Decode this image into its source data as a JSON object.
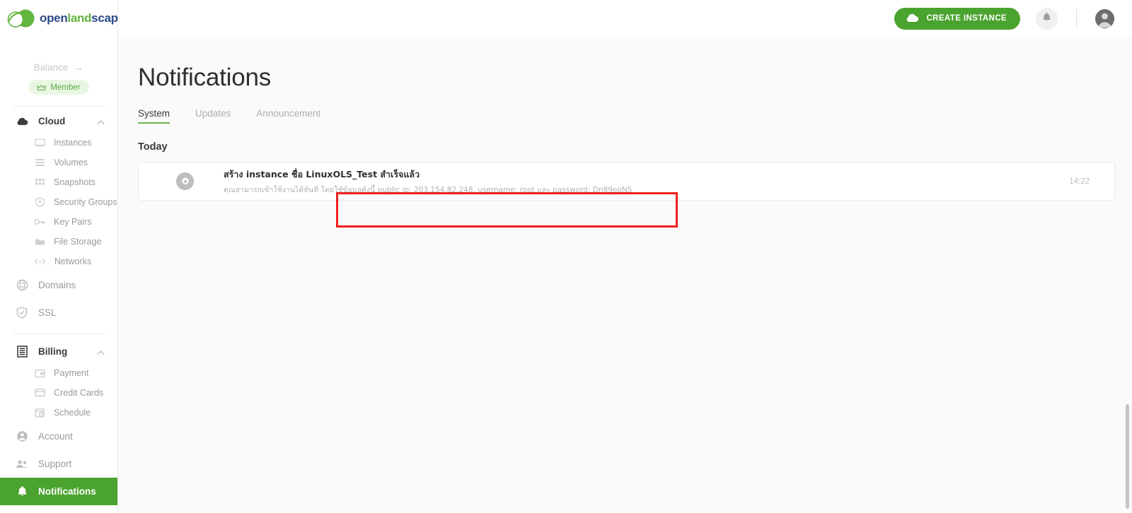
{
  "brand": {
    "logo_open": "open",
    "logo_land": "land",
    "logo_scape": "scape",
    "accent_green": "#4ba32f",
    "tab_underline_green": "#6cb24a",
    "badge_bg": "#e9f7e2",
    "annotation_red": "#ef2020"
  },
  "sidebar": {
    "balance_label": "Balance",
    "balance_arrow": "→",
    "member_badge": "Member",
    "groups": [
      {
        "label": "Cloud",
        "icon": "cloud-icon",
        "expanded": true,
        "items": [
          {
            "label": "Instances",
            "icon": "monitor-icon"
          },
          {
            "label": "Volumes",
            "icon": "layers-icon"
          },
          {
            "label": "Snapshots",
            "icon": "grid-icon"
          },
          {
            "label": "Security Groups",
            "icon": "shield-icon"
          },
          {
            "label": "Key Pairs",
            "icon": "key-icon"
          },
          {
            "label": "File Storage",
            "icon": "folder-icon"
          },
          {
            "label": "Networks",
            "icon": "code-icon"
          }
        ]
      }
    ],
    "standalone": [
      {
        "label": "Domains",
        "icon": "globe-icon"
      },
      {
        "label": "SSL",
        "icon": "shield-check-icon"
      }
    ],
    "billing_group": {
      "label": "Billing",
      "icon": "billing-icon",
      "expanded": true,
      "items": [
        {
          "label": "Payment",
          "icon": "wallet-icon"
        },
        {
          "label": "Credit Cards",
          "icon": "card-icon"
        },
        {
          "label": "Schedule",
          "icon": "schedule-icon"
        }
      ]
    },
    "bottom": [
      {
        "label": "Account",
        "icon": "user-icon",
        "active": false
      },
      {
        "label": "Support",
        "icon": "people-icon",
        "active": false
      },
      {
        "label": "Notifications",
        "icon": "bell-icon",
        "active": true
      }
    ]
  },
  "topbar": {
    "create_instance_label": "CREATE INSTANCE",
    "create_instance_icon": "cloud-icon",
    "bell_icon": "bell-icon",
    "avatar_icon": "avatar"
  },
  "main": {
    "page_title": "Notifications",
    "tabs": [
      {
        "label": "System",
        "active": true
      },
      {
        "label": "Updates",
        "active": false
      },
      {
        "label": "Announcement",
        "active": false
      }
    ],
    "section_label": "Today",
    "notifications": [
      {
        "icon": "gear-icon",
        "title": "สร้าง instance ชื่อ LinuxOLS_Test สำเร็จแล้ว",
        "subtitle": "คุณสามารถเข้าใช้งานได้ทันที โดยใช้ข้อมูลดังนี้ public ip: 203.154.82.248, username: root และ password: Dn89eoNS",
        "time": "14:22"
      }
    ]
  }
}
